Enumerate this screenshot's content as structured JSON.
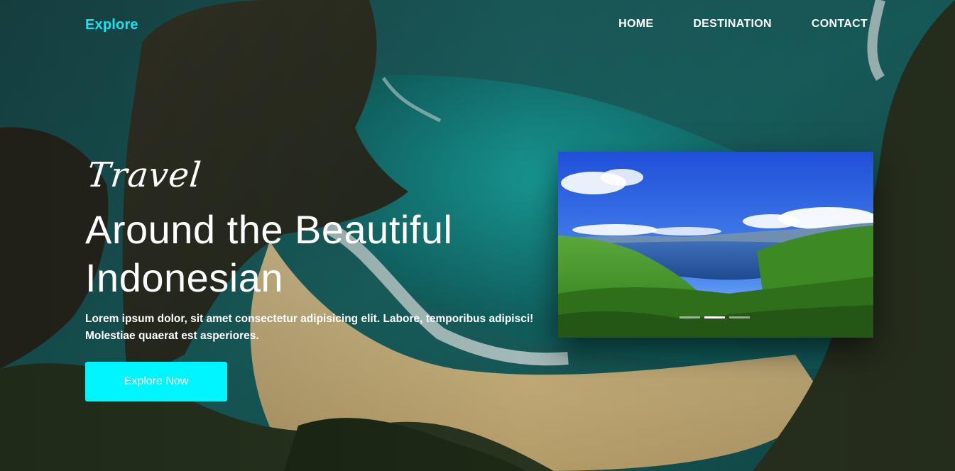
{
  "navbar": {
    "brand": "Explore",
    "links": [
      "HOME",
      "DESTINATION",
      "CONTACT"
    ]
  },
  "hero": {
    "eyebrow": "Travel",
    "headline_line1": "Around the Beautiful",
    "headline_line2": "Indonesian",
    "lead": "Lorem ipsum dolor, sit amet consectetur adipisicing elit. Labore, temporibus adipisci! Molestiae quaerat est asperiores.",
    "cta_label": "Explore Now"
  },
  "slider": {
    "slide_count": 3,
    "active_index": 1
  },
  "colors": {
    "accent": "#00f5ff",
    "brand": "#16e3ee"
  }
}
